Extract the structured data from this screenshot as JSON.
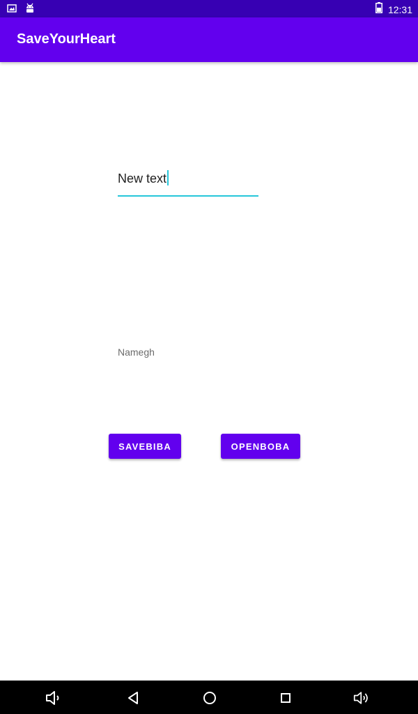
{
  "status_bar": {
    "time": "12:31",
    "icons": [
      "image-notification-icon",
      "android-debug-icon",
      "battery-icon"
    ]
  },
  "app_bar": {
    "title": "SaveYourHeart"
  },
  "edit_field": {
    "value": "New text"
  },
  "label": {
    "text": "Namegh"
  },
  "buttons": {
    "save_label": "SAVEBIBA",
    "open_label": "OPENBOBA"
  },
  "nav_bar": {
    "icons": [
      "volume-down-icon",
      "back-icon",
      "home-icon",
      "recents-icon",
      "volume-up-icon"
    ]
  },
  "colors": {
    "status_bar": "#3700b3",
    "primary": "#6200ee",
    "accent": "#26c6da"
  }
}
